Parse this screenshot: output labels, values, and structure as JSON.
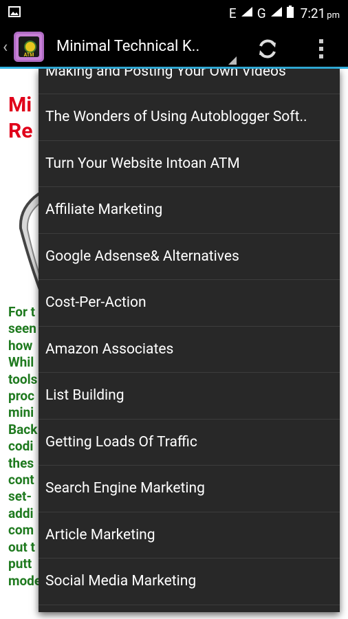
{
  "status_bar": {
    "network_label": "E",
    "network_label_2": "G",
    "time": "7:21",
    "ampm": "pm"
  },
  "action_bar": {
    "title": "Minimal Technical K..",
    "app_icon_text": "ATM"
  },
  "background_page": {
    "title_line1": "Mi",
    "title_line2": "Re",
    "body_lines": [
      "For t",
      "seen",
      "how",
      "Whil",
      "tools",
      "proc",
      "mini",
      "Back",
      "codi",
      "thes",
      "cont",
      "set-",
      "addi",
      "com",
      "out t",
      "putt",
      "mode"
    ]
  },
  "menu": {
    "items": [
      "Making and Posting Your Own Videos",
      "The Wonders of Using Autoblogger Soft..",
      "Turn Your Website Intoan ATM",
      "Affiliate Marketing",
      "Google Adsense& Alternatives",
      "Cost-Per-Action",
      "Amazon Associates",
      "List Building",
      "Getting Loads Of Traffic",
      "Search Engine Marketing",
      "Article Marketing",
      "Social Media Marketing"
    ]
  },
  "colors": {
    "accent": "#33b5e5",
    "menu_bg": "#282828",
    "title_red": "#e0001a",
    "body_green": "#1f7a1f"
  }
}
